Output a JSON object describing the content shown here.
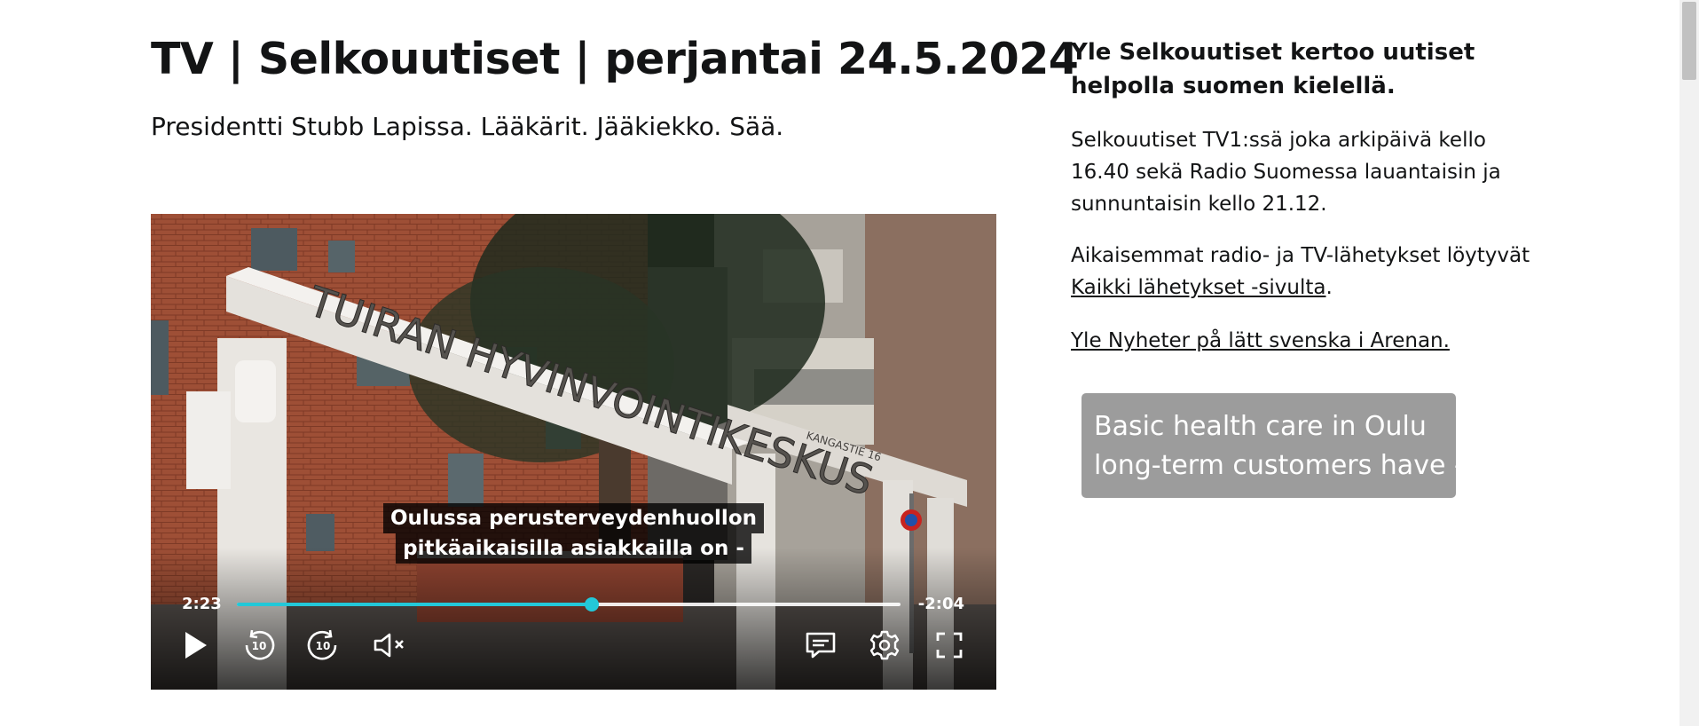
{
  "article": {
    "title": "TV | Selkouutiset | perjantai 24.5.2024",
    "lead": "Presidentti Stubb Lapissa. Lääkärit. Jääkiekko. Sää."
  },
  "player": {
    "subtitle_lines": [
      "Oulussa perusterveydenhuollon",
      "pitkäaikaisilla asiakkailla on -"
    ],
    "scene_text": {
      "sign_main": "TUIRAN  HYVINVOINTIKESKUS",
      "sign_small": "KANGASTIE 16"
    },
    "time_current": "2:23",
    "time_remaining": "-2:04",
    "progress_fraction": 0.535,
    "accent_color": "#23c8d8",
    "icons": [
      "play-icon",
      "rewind-10-icon",
      "forward-10-icon",
      "mute-icon",
      "subtitles-icon",
      "settings-icon",
      "fullscreen-icon"
    ],
    "skip_seconds_label": "10"
  },
  "sidebar": {
    "heading": "Yle Selkouutiset kertoo uutiset helpolla suomen kielellä.",
    "schedule": "Selkouutiset TV1:ssä joka arkipäivä kello 16.40 sekä Radio Suomessa lauantaisin ja sunnuntaisin kello 21.12.",
    "archive_prefix": "Aikaisemmat radio- ja TV-lähetykset löytyvät",
    "archive_link": "Kaikki lähetykset -sivulta",
    "archive_suffix": ".",
    "swedish_link": "Yle Nyheter på lätt svenska i Arenan."
  },
  "translation_overlay": {
    "lines": [
      "Basic health care in Oulu",
      "long-term customers have -"
    ]
  }
}
